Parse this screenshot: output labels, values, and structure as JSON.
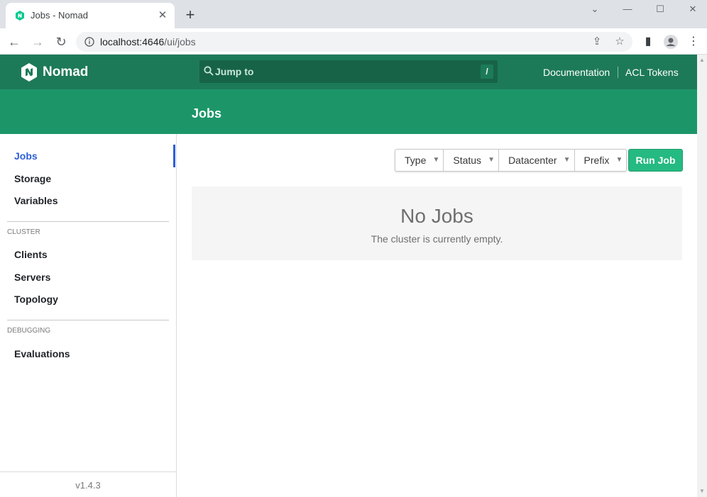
{
  "browser": {
    "tab_title": "Jobs - Nomad",
    "url_host": "localhost:4646",
    "url_path": "/ui/jobs",
    "icons": [
      "nomad-favicon",
      "close-icon",
      "plus-icon",
      "minimize-icon",
      "maximize-icon",
      "window-close-icon",
      "back-icon",
      "forward-icon",
      "reload-icon",
      "info-icon",
      "share-icon",
      "star-icon",
      "sidepanel-icon",
      "profile-icon",
      "menu-icon"
    ]
  },
  "topbar": {
    "brand": "Nomad",
    "search_placeholder": "Jump to",
    "search_shortcut": "/",
    "links": [
      "Documentation",
      "ACL Tokens"
    ]
  },
  "page": {
    "title": "Jobs"
  },
  "sidebar": {
    "items": [
      {
        "label": "Jobs",
        "active": true
      },
      {
        "label": "Storage"
      },
      {
        "label": "Variables"
      }
    ],
    "cluster_heading": "CLUSTER",
    "cluster_items": [
      {
        "label": "Clients"
      },
      {
        "label": "Servers"
      },
      {
        "label": "Topology"
      }
    ],
    "debugging_heading": "DEBUGGING",
    "debugging_items": [
      {
        "label": "Evaluations"
      }
    ],
    "version": "v1.4.3"
  },
  "filters": [
    {
      "label": "Type"
    },
    {
      "label": "Status"
    },
    {
      "label": "Datacenter"
    },
    {
      "label": "Prefix"
    }
  ],
  "actions": {
    "run_job": "Run Job"
  },
  "empty_state": {
    "title": "No Jobs",
    "message": "The cluster is currently empty."
  },
  "colors": {
    "topbar": "#1d7a58",
    "page_header": "#1c9669",
    "primary_button": "#25ba81",
    "active_nav": "#2c5ed8"
  }
}
